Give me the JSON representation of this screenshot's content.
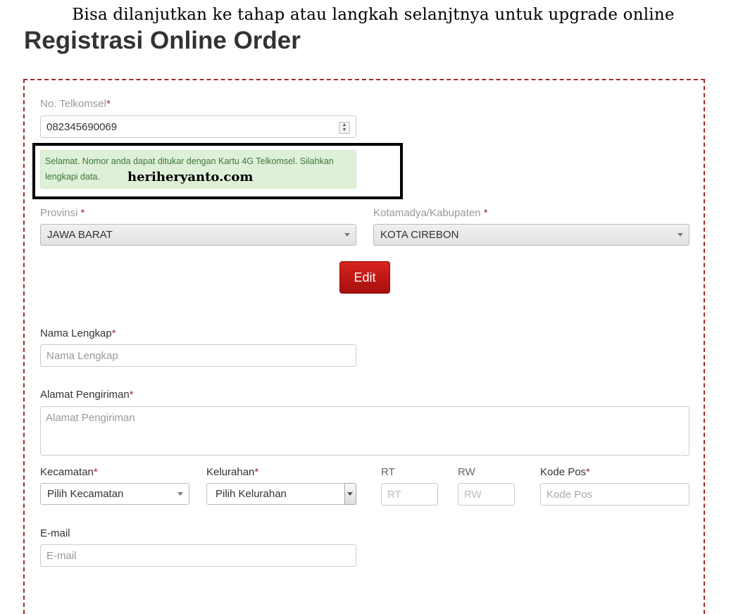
{
  "caption": "Bisa dilanjutkan ke tahap atau langkah selanjtnya untuk upgrade online",
  "page_title": "Registrasi Online Order",
  "watermark": "heriheryanto.com",
  "colors": {
    "accent": "#a52a2a",
    "button": "#c41a16",
    "alert_bg": "#dff0d8",
    "alert_text": "#3c763d"
  },
  "form": {
    "telkomsel": {
      "label": "No. Telkomsel",
      "required": "*",
      "value": "082345690069"
    },
    "alert": "Selamat. Nomor anda dapat ditukar dengan Kartu 4G Telkomsel. Silahkan lengkapi data.",
    "provinsi": {
      "label": "Provinsi ",
      "required": "*",
      "value": "JAWA BARAT"
    },
    "kota": {
      "label": "Kotamadya/Kabupaten ",
      "required": "*",
      "value": "KOTA CIREBON"
    },
    "edit_button": "Edit",
    "nama": {
      "label": "Nama Lengkap",
      "required": "*",
      "placeholder": "Nama Lengkap"
    },
    "alamat": {
      "label": "Alamat Pengiriman",
      "required": "*",
      "placeholder": "Alamat Pengiriman"
    },
    "kecamatan": {
      "label": "Kecamatan",
      "required": "*",
      "value": "Pilih Kecamatan"
    },
    "kelurahan": {
      "label": "Kelurahan",
      "required": "*",
      "value": "Pilih Kelurahan"
    },
    "rt": {
      "label": "RT",
      "placeholder": "RT"
    },
    "rw": {
      "label": "RW",
      "placeholder": "RW"
    },
    "kodepos": {
      "label": "Kode Pos",
      "required": "*",
      "placeholder": "Kode Pos"
    },
    "email": {
      "label": "E-mail",
      "placeholder": "E-mail"
    }
  }
}
